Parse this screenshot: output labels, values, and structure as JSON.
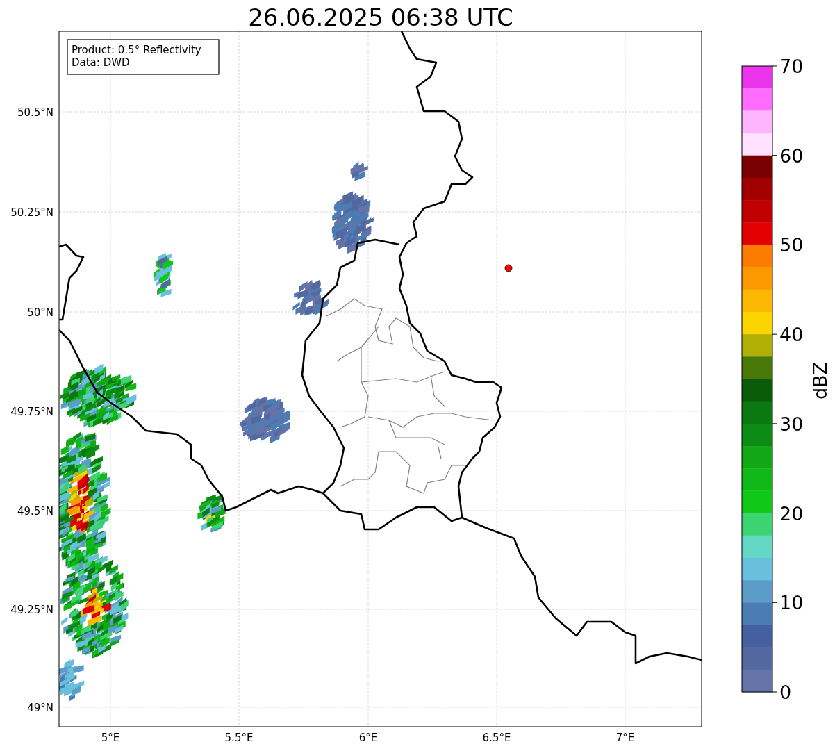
{
  "title": "26.06.2025 06:38 UTC",
  "info_box": [
    "Product: 0.5° Reflectivity",
    "Data: DWD"
  ],
  "lat_ticks": [
    "50.5°N",
    "50.25°N",
    "50°N",
    "49.75°N",
    "49.5°N",
    "49.25°N",
    "49°N"
  ],
  "lon_ticks": [
    "5°E",
    "5.5°E",
    "6°E",
    "6.5°E",
    "7°E"
  ],
  "colorbar": {
    "label": "dBZ",
    "ticks": [
      "70",
      "60",
      "50",
      "40",
      "30",
      "20",
      "10",
      "0"
    ],
    "segments": [
      {
        "color": "#ec34ec"
      },
      {
        "color": "#ff6cff"
      },
      {
        "color": "#ffb4ff"
      },
      {
        "color": "#ffe0ff"
      },
      {
        "color": "#780000"
      },
      {
        "color": "#a00000"
      },
      {
        "color": "#c00000"
      },
      {
        "color": "#e40000"
      },
      {
        "color": "#fc7c00"
      },
      {
        "color": "#fc9800"
      },
      {
        "color": "#fcb800"
      },
      {
        "color": "#fcd400"
      },
      {
        "color": "#b0b004"
      },
      {
        "color": "#487808"
      },
      {
        "color": "#0a5c0a"
      },
      {
        "color": "#0c7810"
      },
      {
        "color": "#0c8c14"
      },
      {
        "color": "#10a814"
      },
      {
        "color": "#10b818"
      },
      {
        "color": "#10c818"
      },
      {
        "color": "#3cd470"
      },
      {
        "color": "#64d8c4"
      },
      {
        "color": "#68c0dc"
      },
      {
        "color": "#5c9cc8"
      },
      {
        "color": "#4c7cb4"
      },
      {
        "color": "#4460a0"
      },
      {
        "color": "#5468a0"
      },
      {
        "color": "#6474a8"
      }
    ]
  }
}
